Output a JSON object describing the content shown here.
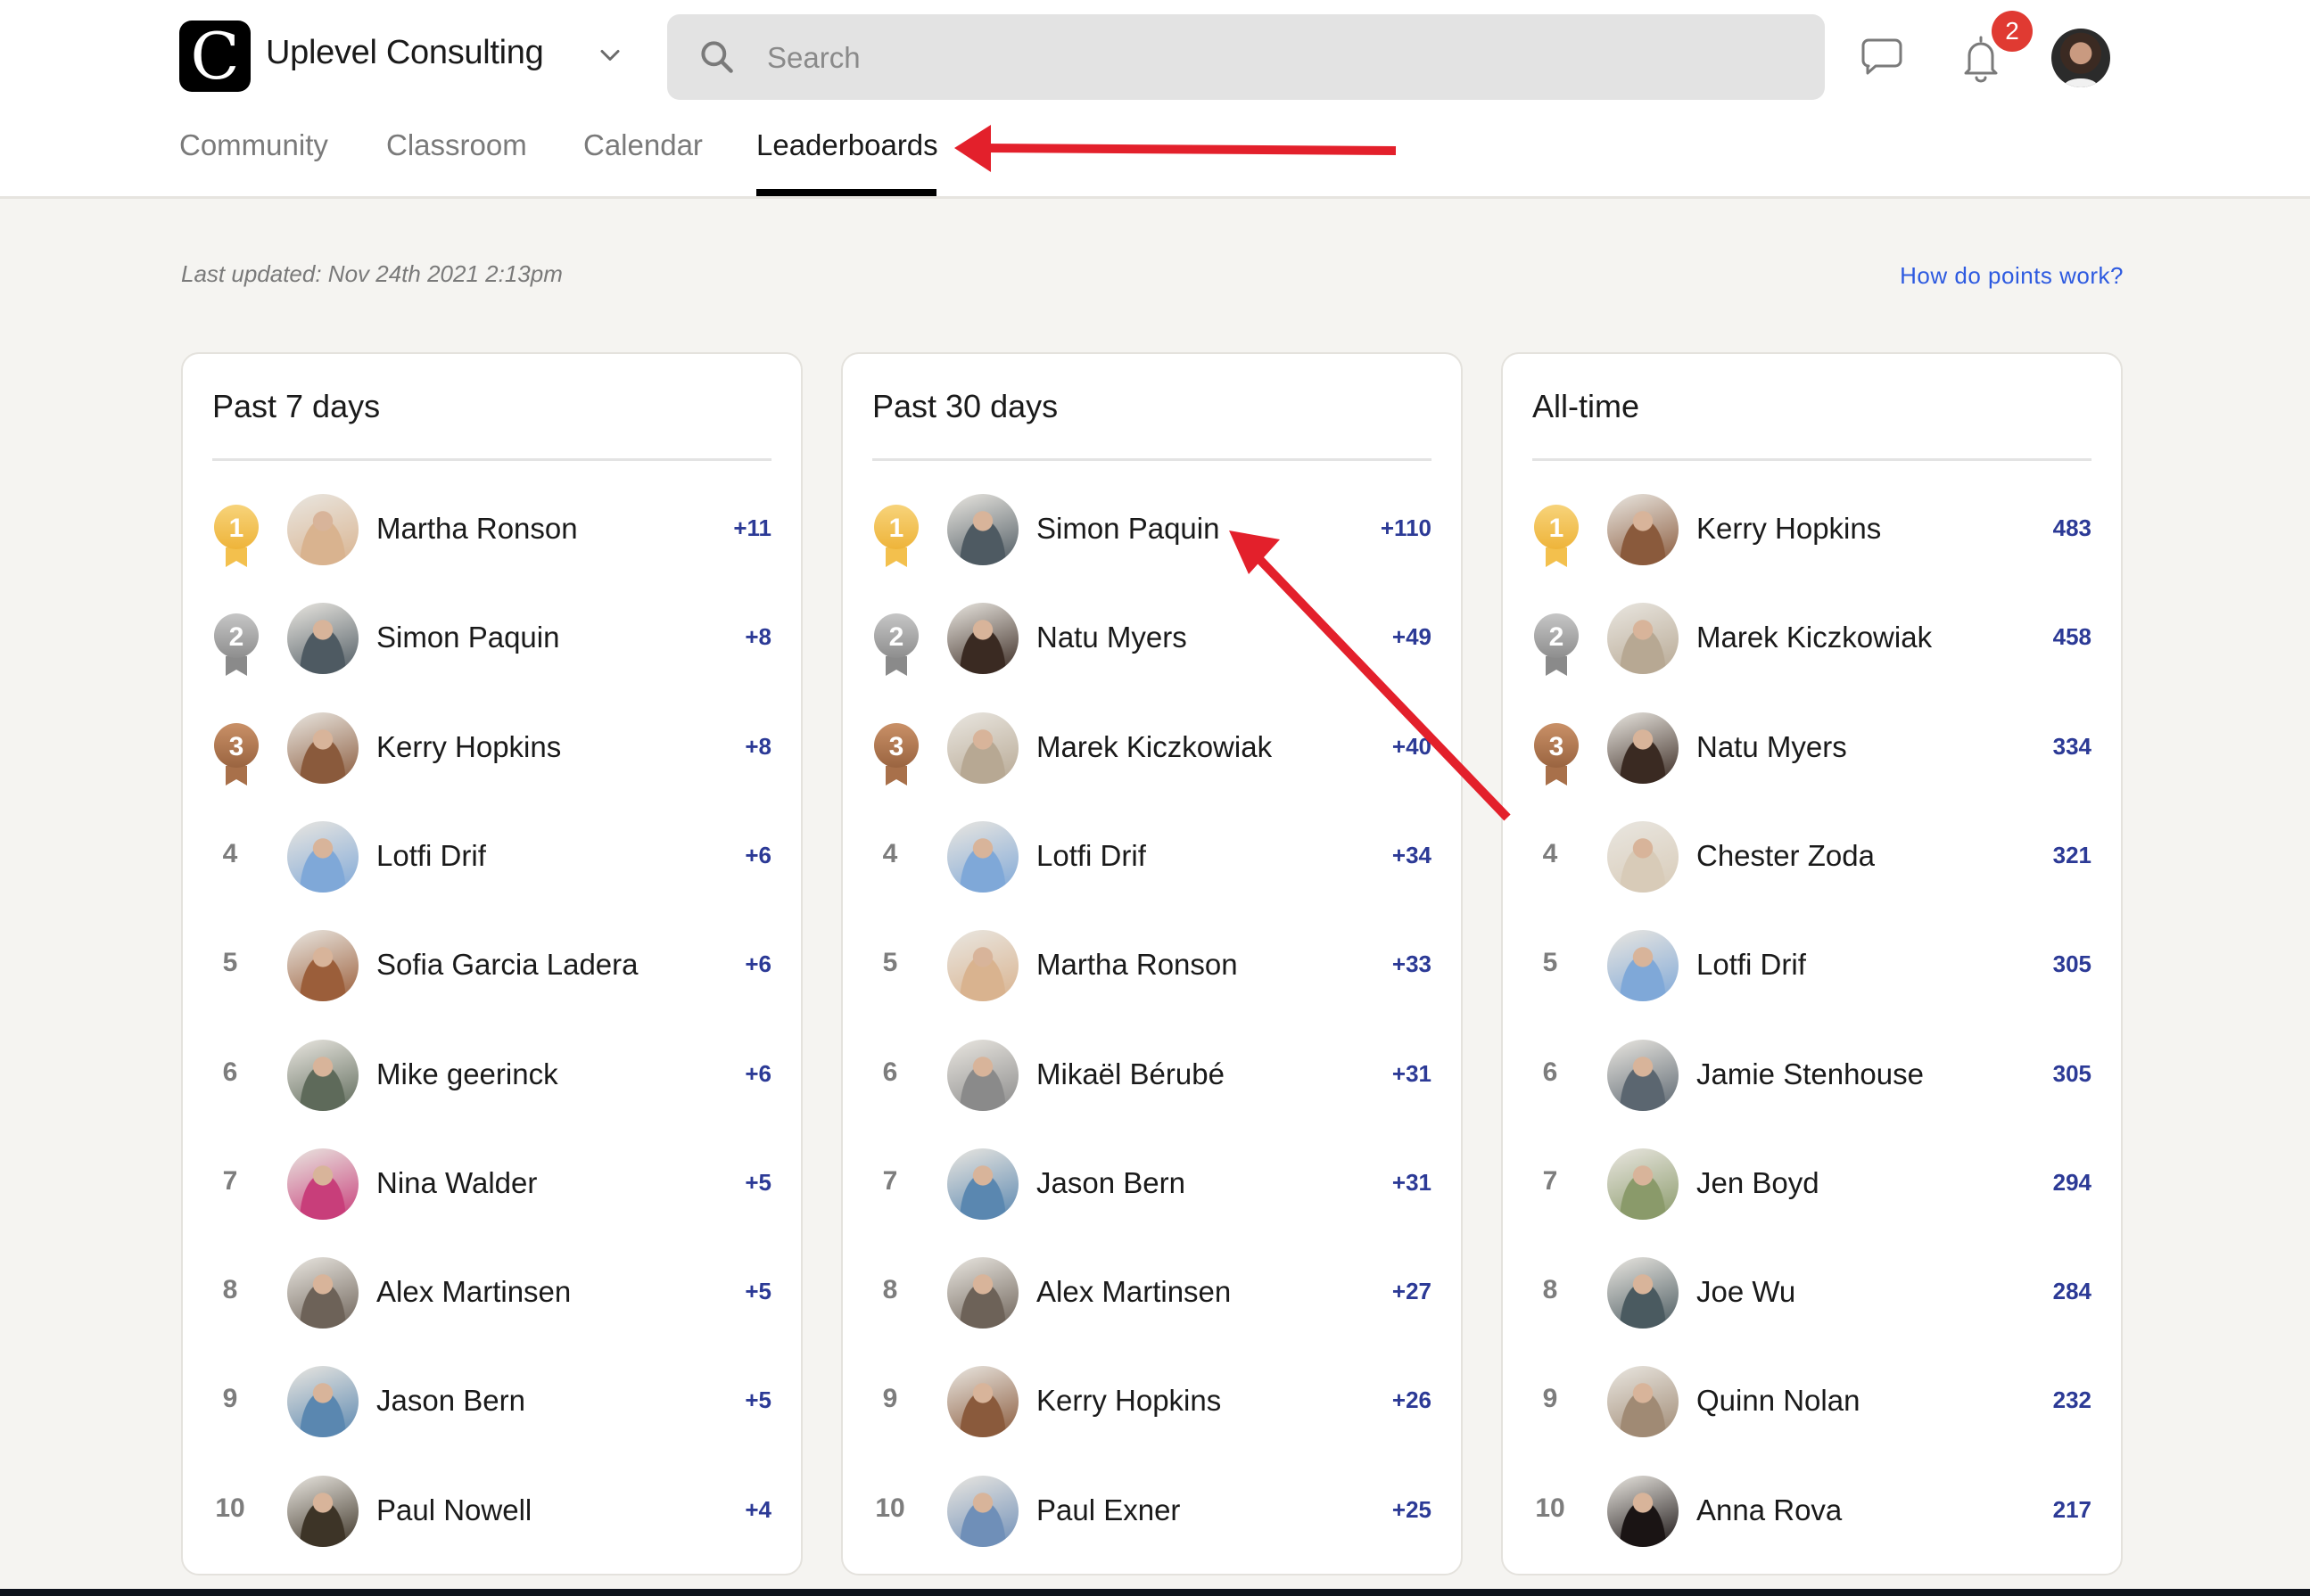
{
  "header": {
    "brand_name": "Uplevel Consulting",
    "logo_letter": "C",
    "search_placeholder": "Search",
    "notification_count": "2",
    "tabs": [
      {
        "label": "Community",
        "active": false
      },
      {
        "label": "Classroom",
        "active": false
      },
      {
        "label": "Calendar",
        "active": false
      },
      {
        "label": "Leaderboards",
        "active": true
      }
    ]
  },
  "page": {
    "last_updated": "Last updated: Nov 24th 2021 2:13pm",
    "points_link": "How do points work?"
  },
  "colors": {
    "accent_link": "#2d5ae0",
    "score": "#2c3a96",
    "badge": "#e03a32",
    "gold": "#f3c04d",
    "silver": "#9a9a9a",
    "bronze": "#a8704a",
    "annotation_arrow": "#e3202b"
  },
  "leaderboards": [
    {
      "title": "Past 7 days",
      "entries": [
        {
          "rank": "1",
          "name": "Martha Ronson",
          "score": "+11",
          "avatar_color": "#d9b38f"
        },
        {
          "rank": "2",
          "name": "Simon Paquin",
          "score": "+8",
          "avatar_color": "#4e5a62"
        },
        {
          "rank": "3",
          "name": "Kerry Hopkins",
          "score": "+8",
          "avatar_color": "#8a5a3c"
        },
        {
          "rank": "4",
          "name": "Lotfi Drif",
          "score": "+6",
          "avatar_color": "#7fa8d8"
        },
        {
          "rank": "5",
          "name": "Sofia Garcia Ladera",
          "score": "+6",
          "avatar_color": "#9b5e3a"
        },
        {
          "rank": "6",
          "name": "Mike geerinck",
          "score": "+6",
          "avatar_color": "#5e6a5a"
        },
        {
          "rank": "7",
          "name": "Nina Walder",
          "score": "+5",
          "avatar_color": "#c83e7a"
        },
        {
          "rank": "8",
          "name": "Alex Martinsen",
          "score": "+5",
          "avatar_color": "#6d6258"
        },
        {
          "rank": "9",
          "name": "Jason Bern",
          "score": "+5",
          "avatar_color": "#5a87b0"
        },
        {
          "rank": "10",
          "name": "Paul Nowell",
          "score": "+4",
          "avatar_color": "#3d3427"
        }
      ]
    },
    {
      "title": "Past 30 days",
      "entries": [
        {
          "rank": "1",
          "name": "Simon Paquin",
          "score": "+110",
          "avatar_color": "#4e5a62"
        },
        {
          "rank": "2",
          "name": "Natu Myers",
          "score": "+49",
          "avatar_color": "#3a2a22"
        },
        {
          "rank": "3",
          "name": "Marek Kiczkowiak",
          "score": "+40",
          "avatar_color": "#b7a893"
        },
        {
          "rank": "4",
          "name": "Lotfi Drif",
          "score": "+34",
          "avatar_color": "#7fa8d8"
        },
        {
          "rank": "5",
          "name": "Martha Ronson",
          "score": "+33",
          "avatar_color": "#d9b38f"
        },
        {
          "rank": "6",
          "name": "Mikaël Bérubé",
          "score": "+31",
          "avatar_color": "#8a8a8a"
        },
        {
          "rank": "7",
          "name": "Jason Bern",
          "score": "+31",
          "avatar_color": "#5a87b0"
        },
        {
          "rank": "8",
          "name": "Alex Martinsen",
          "score": "+27",
          "avatar_color": "#6d6258"
        },
        {
          "rank": "9",
          "name": "Kerry Hopkins",
          "score": "+26",
          "avatar_color": "#8a5a3c"
        },
        {
          "rank": "10",
          "name": "Paul Exner",
          "score": "+25",
          "avatar_color": "#6f8fb8"
        }
      ]
    },
    {
      "title": "All-time",
      "entries": [
        {
          "rank": "1",
          "name": "Kerry Hopkins",
          "score": "483",
          "avatar_color": "#8a5a3c"
        },
        {
          "rank": "2",
          "name": "Marek Kiczkowiak",
          "score": "458",
          "avatar_color": "#b7a893"
        },
        {
          "rank": "3",
          "name": "Natu Myers",
          "score": "334",
          "avatar_color": "#3a2a22"
        },
        {
          "rank": "4",
          "name": "Chester Zoda",
          "score": "321",
          "avatar_color": "#d8cbb8"
        },
        {
          "rank": "5",
          "name": "Lotfi Drif",
          "score": "305",
          "avatar_color": "#7fa8d8"
        },
        {
          "rank": "6",
          "name": "Jamie Stenhouse",
          "score": "305",
          "avatar_color": "#5b6670"
        },
        {
          "rank": "7",
          "name": "Jen Boyd",
          "score": "294",
          "avatar_color": "#8a9a6a"
        },
        {
          "rank": "8",
          "name": "Joe Wu",
          "score": "284",
          "avatar_color": "#4a5a60"
        },
        {
          "rank": "9",
          "name": "Quinn Nolan",
          "score": "232",
          "avatar_color": "#a08a74"
        },
        {
          "rank": "10",
          "name": "Anna Rova",
          "score": "217",
          "avatar_color": "#1a1414"
        }
      ]
    }
  ]
}
